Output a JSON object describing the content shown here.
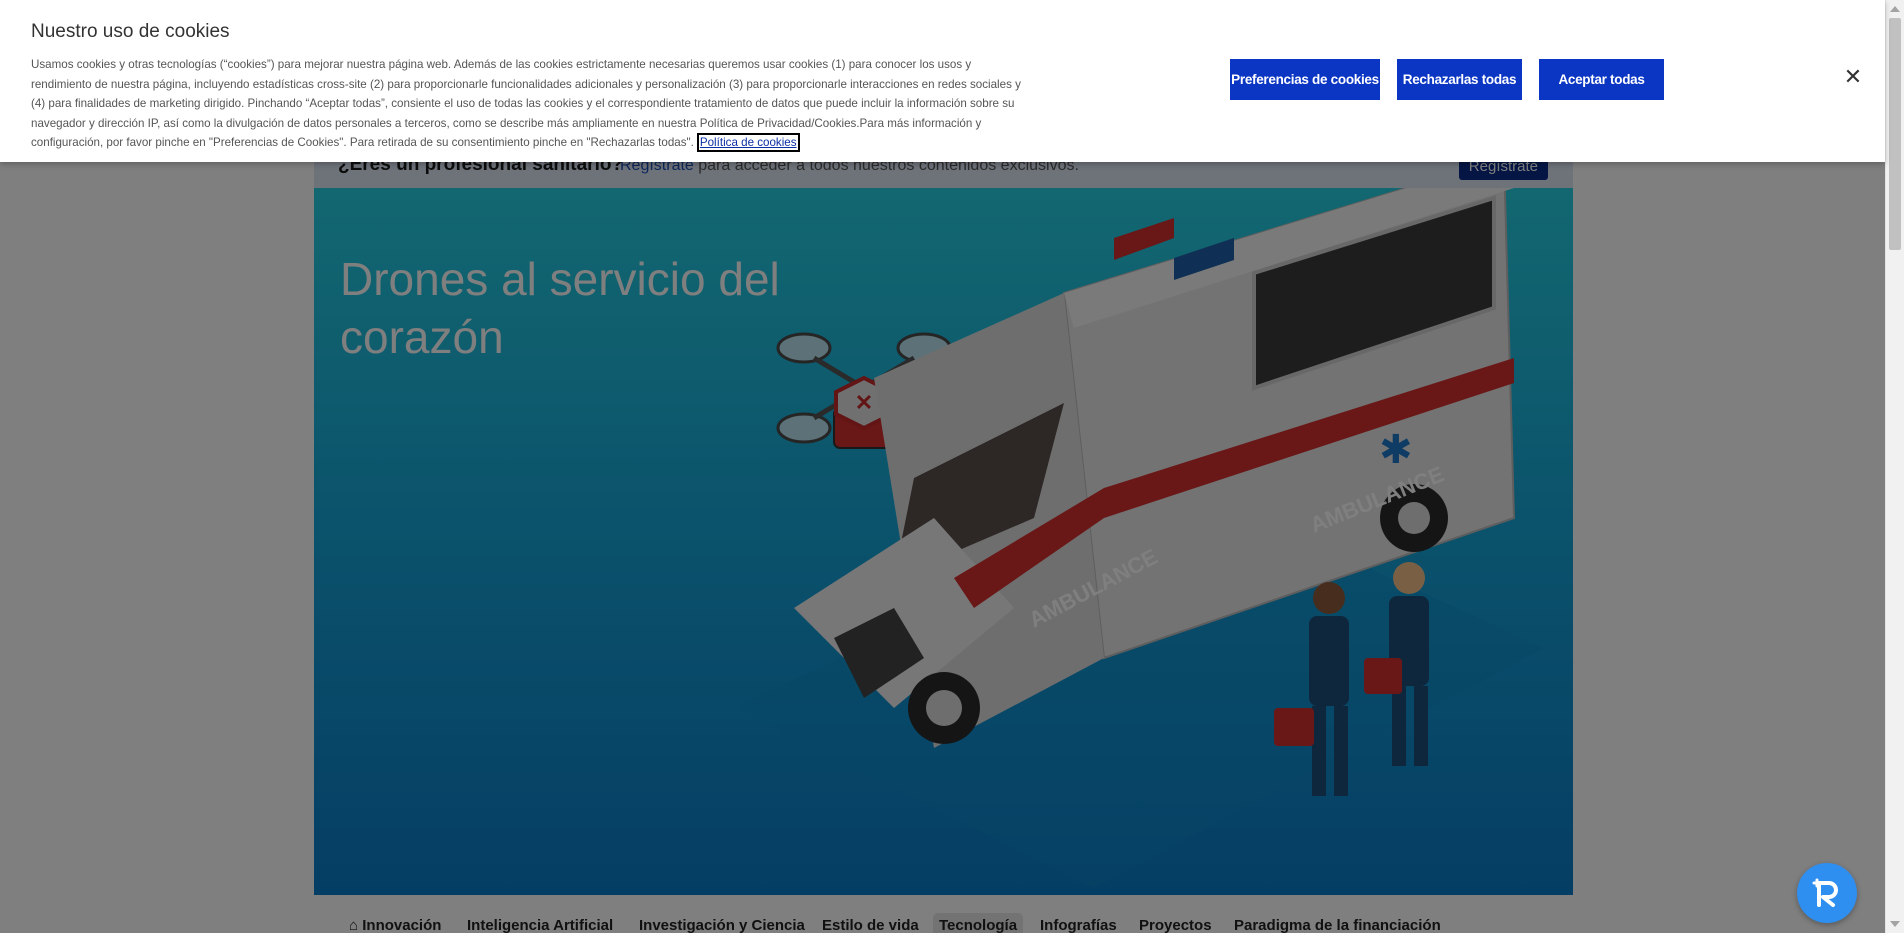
{
  "cookie_banner": {
    "title": "Nuestro uso de cookies",
    "body": "Usamos cookies y otras tecnologías (“cookies”) para mejorar nuestra página web. Además de las cookies estrictamente necesarias queremos usar cookies (1) para conocer los usos y rendimiento de nuestra página, incluyendo estadísticas cross-site (2) para proporcionarle funcionalidades adicionales y personalización (3) para proporcionarle interacciones en redes sociales y (4) para finalidades de marketing dirigido. Pinchando “Aceptar todas”, consiente el uso de todas las cookies y el correspondiente tratamiento de datos que puede incluir la información sobre su navegador y dirección IP, así como la divulgación de datos personales a terceros, como se describe más ampliamente en nuestra Política de Privacidad/Cookies.Para más información y configuración, por favor pinche en \"Preferencias de Cookies\". Para retirada de su consentimiento pinche en \"Rechazarlas todas\".",
    "policy_link": "Política de cookies",
    "buttons": {
      "preferences": "Preferencias de cookies",
      "reject_all": "Rechazarlas todas",
      "accept_all": "Aceptar todas"
    },
    "close_icon": "close-icon"
  },
  "professional_bar": {
    "question": "¿Eres un profesional sanitario?",
    "link": "Regístrate",
    "text": " para acceder a todos nuestros contenidos exclusivos.",
    "button": "Regístrate"
  },
  "hero": {
    "title": "Drones al servicio del corazón",
    "illustration": "ambulance-drone-illustration"
  },
  "nav": {
    "items": [
      {
        "label": "Innovación",
        "icon": "home-icon"
      },
      {
        "label": "Inteligencia Artificial"
      },
      {
        "label": "Investigación y Ciencia"
      },
      {
        "label": "Estilo de vida"
      },
      {
        "label": "Tecnología",
        "active": true
      },
      {
        "label": "Infografías"
      },
      {
        "label": "Proyectos"
      },
      {
        "label": "Paradigma de la financiación"
      }
    ]
  },
  "colors": {
    "primary_button": "#0b36c4",
    "hero_gradient_top": "#25cfe2",
    "hero_gradient_bottom": "#0b7cc8",
    "fab": "#2f8ff0"
  },
  "floating_button": {
    "icon": "assistant-icon"
  }
}
